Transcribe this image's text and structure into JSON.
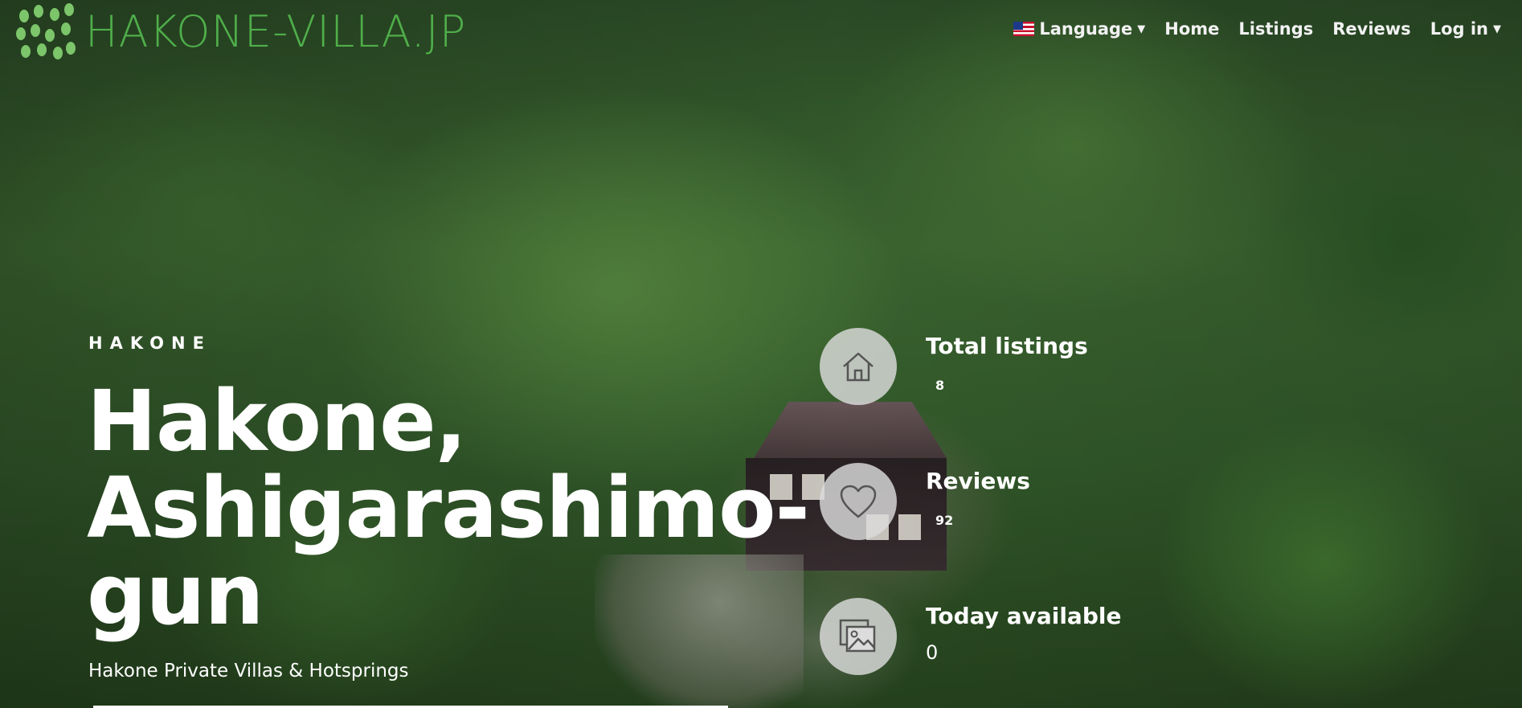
{
  "site": {
    "logo_text": "HAKONE-VILLA.JP"
  },
  "nav": {
    "language": "Language",
    "home": "Home",
    "listings": "Listings",
    "reviews": "Reviews",
    "login": "Log in"
  },
  "hero": {
    "kicker": "HAKONE",
    "title": "Hakone, Ashigarashimo-gun",
    "subtitle": "Hakone Private Villas & Hotsprings"
  },
  "stats": [
    {
      "label": "Total listings",
      "value": "8",
      "icon": "home-icon"
    },
    {
      "label": "Reviews",
      "value": "92",
      "icon": "heart-icon"
    },
    {
      "label": "Today available",
      "value": "0",
      "icon": "image-gallery-icon"
    }
  ],
  "colors": {
    "logo_green": "#4fae4a",
    "text": "#ffffff",
    "stat_circle": "#dcdcdc"
  }
}
